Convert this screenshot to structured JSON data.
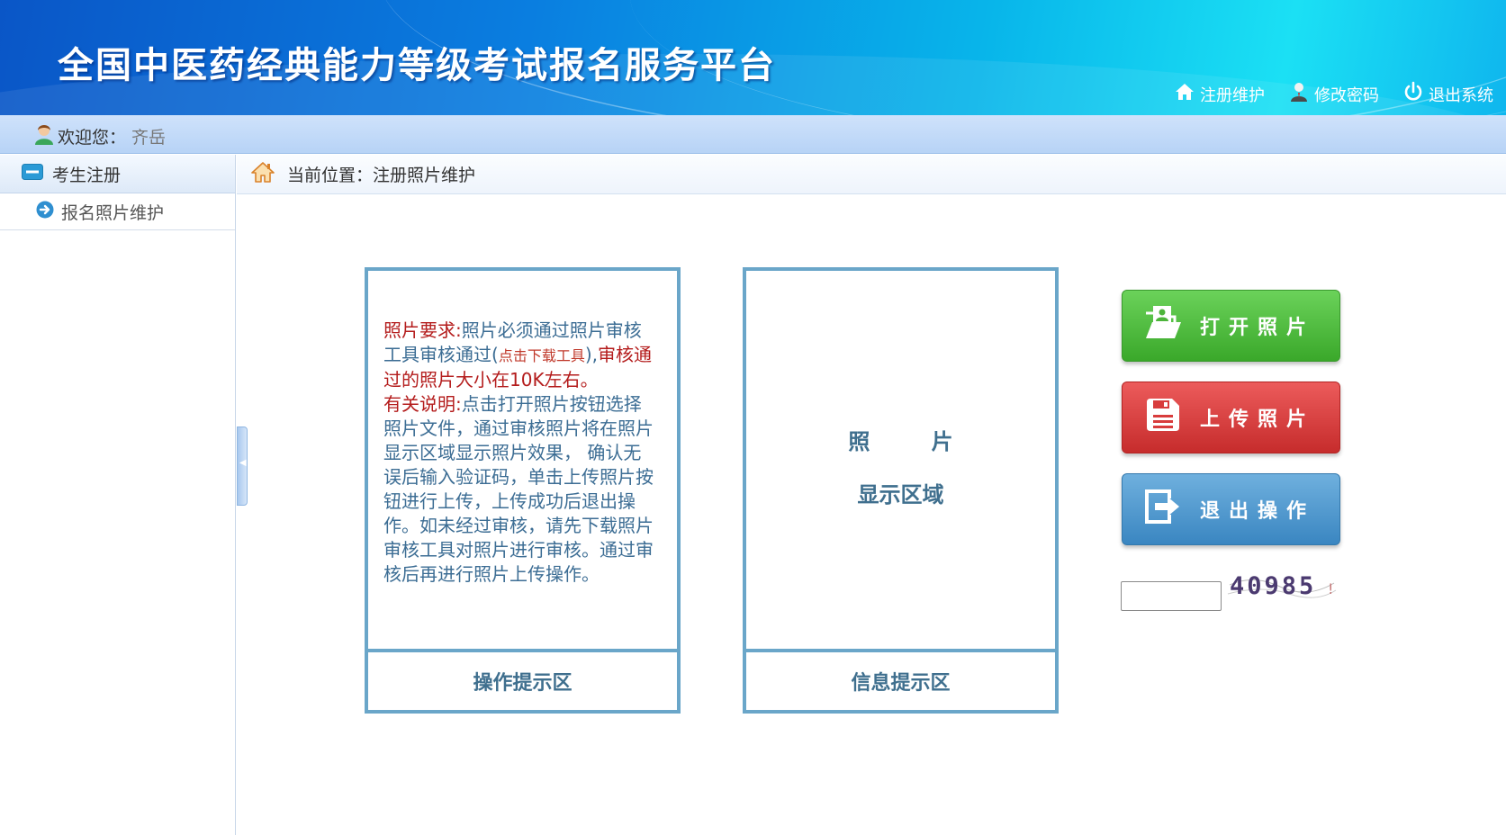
{
  "header": {
    "site_title": "全国中医药经典能力等级考试报名服务平台",
    "links": {
      "register_label": "注册维护",
      "password_label": "修改密码",
      "logout_label": "退出系统"
    }
  },
  "welcome": {
    "label": "欢迎您：",
    "user_name": "齐岳"
  },
  "sidebar": {
    "group_label": "考生注册",
    "items": [
      {
        "label": "报名照片维护"
      }
    ]
  },
  "breadcrumb": {
    "prefix": "当前位置：",
    "current": "注册照片维护"
  },
  "ops_panel": {
    "req_title": "照片要求:",
    "req_text_1": "照片必须通过照片审核工具审核通过(",
    "download_link": "点击下载工具",
    "req_text_2": "),",
    "req_text_3": "审核通过的照片大小在10K左右。",
    "note_title": "有关说明:",
    "note_text": "点击打开照片按钮选择照片文件，通过审核照片将在照片显示区域显示照片效果， 确认无误后输入验证码，单击上传照片按钮进行上传，上传成功后退出操作。如未经过审核，请先下载照片审核工具对照片进行审核。通过审核后再进行照片上传操作。",
    "footer": "操作提示区"
  },
  "info_panel": {
    "photo_line1": "照 片",
    "photo_line2": "显示区域",
    "footer": "信息提示区"
  },
  "actions": {
    "open_label": "打开照片",
    "upload_label": "上传照片",
    "exit_label": "退出操作"
  },
  "captcha": {
    "input_value": "",
    "code": "40985"
  },
  "colors": {
    "header_blue": "#0a7ee0",
    "panel_border": "#6aa6c9",
    "open_green": "#3aa82a",
    "upload_red": "#c62c2c",
    "exit_blue": "#3a86c1",
    "note_red": "#b41c1c"
  },
  "icons": {
    "register": "home-icon",
    "password": "user-icon",
    "logout": "power-icon",
    "welcome": "user-avatar-icon",
    "group": "minus-box-icon",
    "item": "arrow-circle-icon",
    "breadcrumb": "home-icon",
    "open": "folder-photo-icon",
    "upload": "save-icon",
    "exit": "exit-icon"
  }
}
